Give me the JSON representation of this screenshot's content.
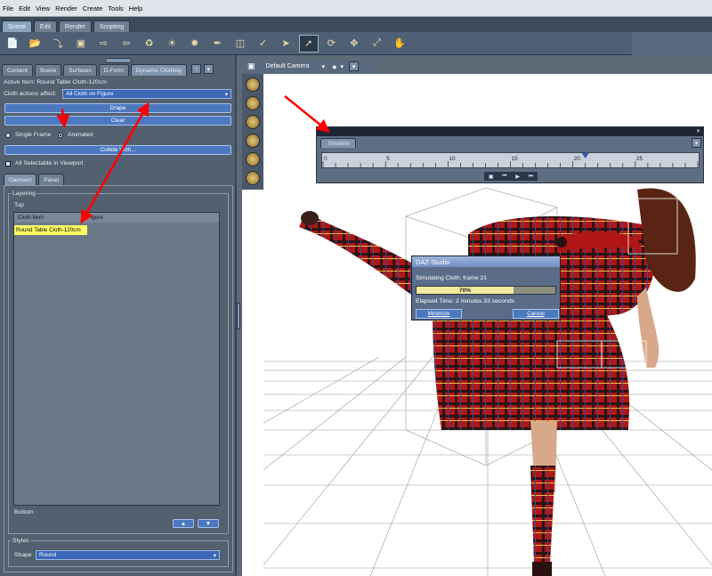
{
  "menu": [
    "File",
    "Edit",
    "View",
    "Render",
    "Create",
    "Tools",
    "Help"
  ],
  "main_tabs": [
    "Scene",
    "Edit",
    "Render",
    "Scripting"
  ],
  "toolbar_icons": [
    "new-file-icon",
    "open-folder-icon",
    "merge-icon",
    "save-icon",
    "import-icon",
    "export-icon",
    "figure-icon",
    "light-icon",
    "sun-icon",
    "wand-icon",
    "cube-icon",
    "brush-icon",
    "pointer-icon",
    "select-arrow-icon",
    "rotate-icon",
    "translate-icon",
    "scale-icon",
    "hand-icon"
  ],
  "panel": {
    "tabs": [
      "Content",
      "Scene",
      "Surfaces",
      "D-Form",
      "Dynamic Clothing"
    ],
    "active_item": "Active Item: Round Table Cloth-120cm",
    "cloth_actions_label": "Cloth actions affect:",
    "cloth_actions_value": "All Cloth on Figure",
    "drape": "Drape",
    "clear": "Clear",
    "single_frame": "Single Frame",
    "animated": "Animated",
    "collide_with": "Collide With...",
    "all_selectable": "All Selectable in Viewport",
    "subtabs": [
      "Garment",
      "Panel"
    ],
    "layering": "Layering",
    "top": "Top",
    "bottom": "Bottom",
    "col_cloth": "Cloth Item",
    "col_figure": "Figure",
    "rows": [
      {
        "cloth": "Round Table Cloth-120cm",
        "figure": ""
      }
    ],
    "styles": "Styles",
    "shape_label": "Shape",
    "shape_value": "Round"
  },
  "viewport": {
    "camera": "Default Camera"
  },
  "timeline": {
    "tab": "Timeline",
    "ticks": [
      "0",
      "5",
      "10",
      "15",
      "20",
      "25",
      "30"
    ],
    "current_frame": 21,
    "max_frame": 30
  },
  "dialog": {
    "title": "DAZ Studio",
    "message": "Simulating Cloth: frame 21",
    "progress_label": "70%",
    "progress": 0.7,
    "elapsed": "Elapsed Time:  2 minutes 33 seconds",
    "minimize": "Minimize",
    "cancel": "Cancel"
  },
  "colors": {
    "accent": "#4c78c0",
    "highlight": "#ffff66",
    "annotation": "#ff0000"
  }
}
